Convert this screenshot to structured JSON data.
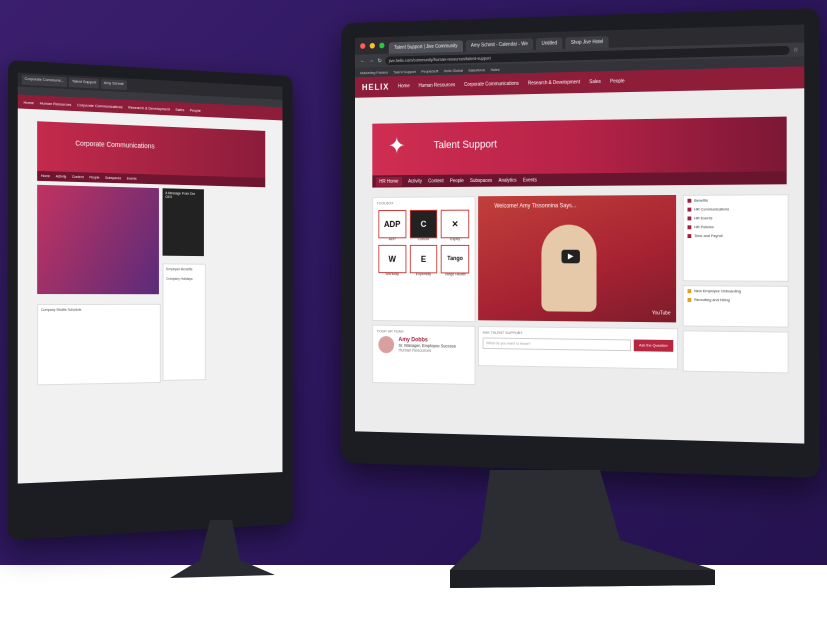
{
  "left_screen": {
    "tabs": [
      "Corporate Communic...",
      "Talent Support",
      "Amy Schmit"
    ],
    "nav": [
      "Home",
      "Human Resources",
      "Corporate Communications",
      "Research & Development",
      "Sales",
      "People"
    ],
    "banner_title": "Corporate Communications",
    "subnav": [
      "Home",
      "Activity",
      "Content",
      "People",
      "Subspaces",
      "Events"
    ],
    "video_caption": "A Message From Our CEO",
    "section_news": "Company Shuttle Schedule",
    "side_items": [
      "Employee Benefits",
      "Company Holidays"
    ]
  },
  "right_screen": {
    "tabs": [
      "Talent Support | Jive Community",
      "Amy Schmit - Calendar - We",
      "Untitled",
      "Shop Jive Hotel"
    ],
    "url": "jive.helix.com/community/human-resources/talent-support",
    "bookmarks": [
      "Marketing Folders",
      "Talent Support",
      "PeopleSoft",
      "Helix Global",
      "Salesforce",
      "Sales"
    ],
    "logo": "HELIX",
    "nav": [
      "Home",
      "Human Resources",
      "Corporate Communications",
      "Research & Development",
      "Sales",
      "People"
    ],
    "banner_title": "Talent Support",
    "subnav": [
      "HR Home",
      "Activity",
      "Content",
      "People",
      "Subspaces",
      "Analytics",
      "Events"
    ],
    "toolbox_header": "TOOLBOX",
    "tools": [
      {
        "icon": "ADP",
        "label": "ADP"
      },
      {
        "icon": "C",
        "label": "Concur"
      },
      {
        "icon": "✕",
        "label": "Expiry"
      },
      {
        "icon": "W",
        "label": "Workday"
      },
      {
        "icon": "E",
        "label": "Expensify"
      },
      {
        "icon": "Tango",
        "label": "Tango Health"
      }
    ],
    "video_title": "Welcome! Amy Tissonnina Says...",
    "video_brand": "YouTube",
    "side_list": [
      "Benefits",
      "HR Communications",
      "HR Events",
      "HR Policies",
      "Time and Payroll"
    ],
    "side_list2": [
      "New Employee Onboarding",
      "Recruiting and Hiring"
    ],
    "hr_header": "YOUR HR TEAM",
    "hr_name": "Amy Dobbs",
    "hr_role": "Sr. Manager, Employee Success",
    "hr_dept": "Human Resources",
    "ask_header": "ASK TALENT SUPPORT",
    "ask_placeholder": "What do you want to know?",
    "ask_button": "Ask the Question"
  }
}
